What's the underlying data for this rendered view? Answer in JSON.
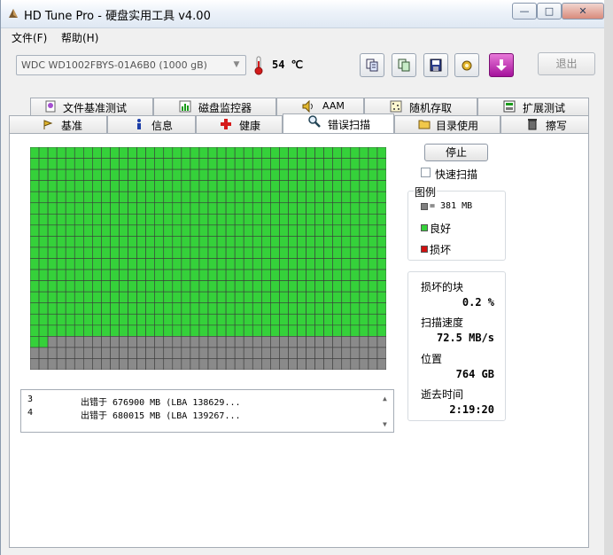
{
  "window": {
    "title": "HD Tune Pro - 硬盘实用工具 v4.00",
    "minimize_glyph": "—",
    "maximize_glyph": "□",
    "close_glyph": "✕"
  },
  "menu": [
    {
      "label": "文件(F)"
    },
    {
      "label": "帮助(H)"
    }
  ],
  "toolbar": {
    "drive": "WDC WD1002FBYS-01A6B0 (1000 gB)",
    "temperature": "54 ℃",
    "icons": [
      "copy-text-icon",
      "copy-screen-icon",
      "save-icon",
      "options-icon",
      "download-icon"
    ],
    "exit_label": "退出"
  },
  "tabs_top": [
    {
      "label": "文件基准测试",
      "icon": "file-benchmark-icon"
    },
    {
      "label": "磁盘监控器",
      "icon": "disk-monitor-icon"
    },
    {
      "label": "AAM",
      "icon": "speaker-icon"
    },
    {
      "label": "随机存取",
      "icon": "random-access-icon"
    },
    {
      "label": "扩展测试",
      "icon": "extra-tests-icon"
    }
  ],
  "tabs_bottom": [
    {
      "label": "基准",
      "icon": "benchmark-icon"
    },
    {
      "label": "信息",
      "icon": "info-icon"
    },
    {
      "label": "健康",
      "icon": "health-icon"
    },
    {
      "label": "错误扫描",
      "icon": "magnifier-icon",
      "active": true
    },
    {
      "label": "目录使用",
      "icon": "folder-icon"
    },
    {
      "label": "擦写",
      "icon": "erase-icon"
    }
  ],
  "scan": {
    "rows": 20,
    "cols": 40,
    "good_rows": 17,
    "good_color": "#35d13a",
    "pending_color": "#8a8a8a",
    "grid_line_color": "#3a3a3a"
  },
  "log": [
    {
      "index": "3",
      "text": "出错于 676900 MB (LBA 138629..."
    },
    {
      "index": "4",
      "text": "出错于 680015 MB (LBA 139267..."
    }
  ],
  "controls": {
    "stop_label": "停止",
    "quick_scan_label": "快速扫描",
    "quick_scan_checked": false
  },
  "legend": {
    "title": "图例",
    "block_size": "= 381 MB",
    "good": "良好",
    "bad": "损坏",
    "block_color": "#808080",
    "good_color": "#35d13a",
    "bad_color": "#d01010"
  },
  "stats": {
    "bad_blocks_label": "损坏的块",
    "bad_blocks_value": "0.2 %",
    "speed_label": "扫描速度",
    "speed_value": "72.5 MB/s",
    "position_label": "位置",
    "position_value": "764 GB",
    "elapsed_label": "逝去时间",
    "elapsed_value": "2:19:20"
  }
}
